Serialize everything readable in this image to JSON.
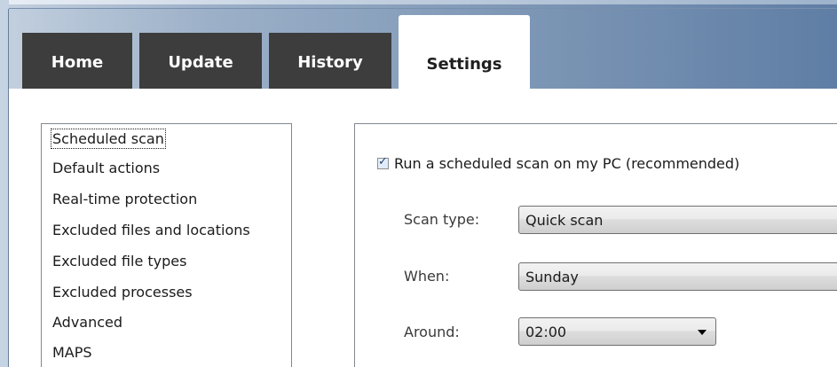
{
  "tabs": {
    "home": "Home",
    "update": "Update",
    "history": "History",
    "settings": "Settings"
  },
  "sidebar": {
    "items": [
      "Scheduled scan",
      "Default actions",
      "Real-time protection",
      "Excluded files and locations",
      "Excluded file types",
      "Excluded processes",
      "Advanced",
      "MAPS"
    ],
    "selected": "Scheduled scan"
  },
  "scheduled_scan": {
    "checkbox_label": "Run a scheduled scan on my PC (recommended)",
    "checkbox_checked": true,
    "checkmark_glyph": "✓",
    "scan_type_label": "Scan type:",
    "scan_type_value": "Quick scan",
    "when_label": "When:",
    "when_value": "Sunday",
    "around_label": "Around:",
    "around_value": "02:00"
  }
}
